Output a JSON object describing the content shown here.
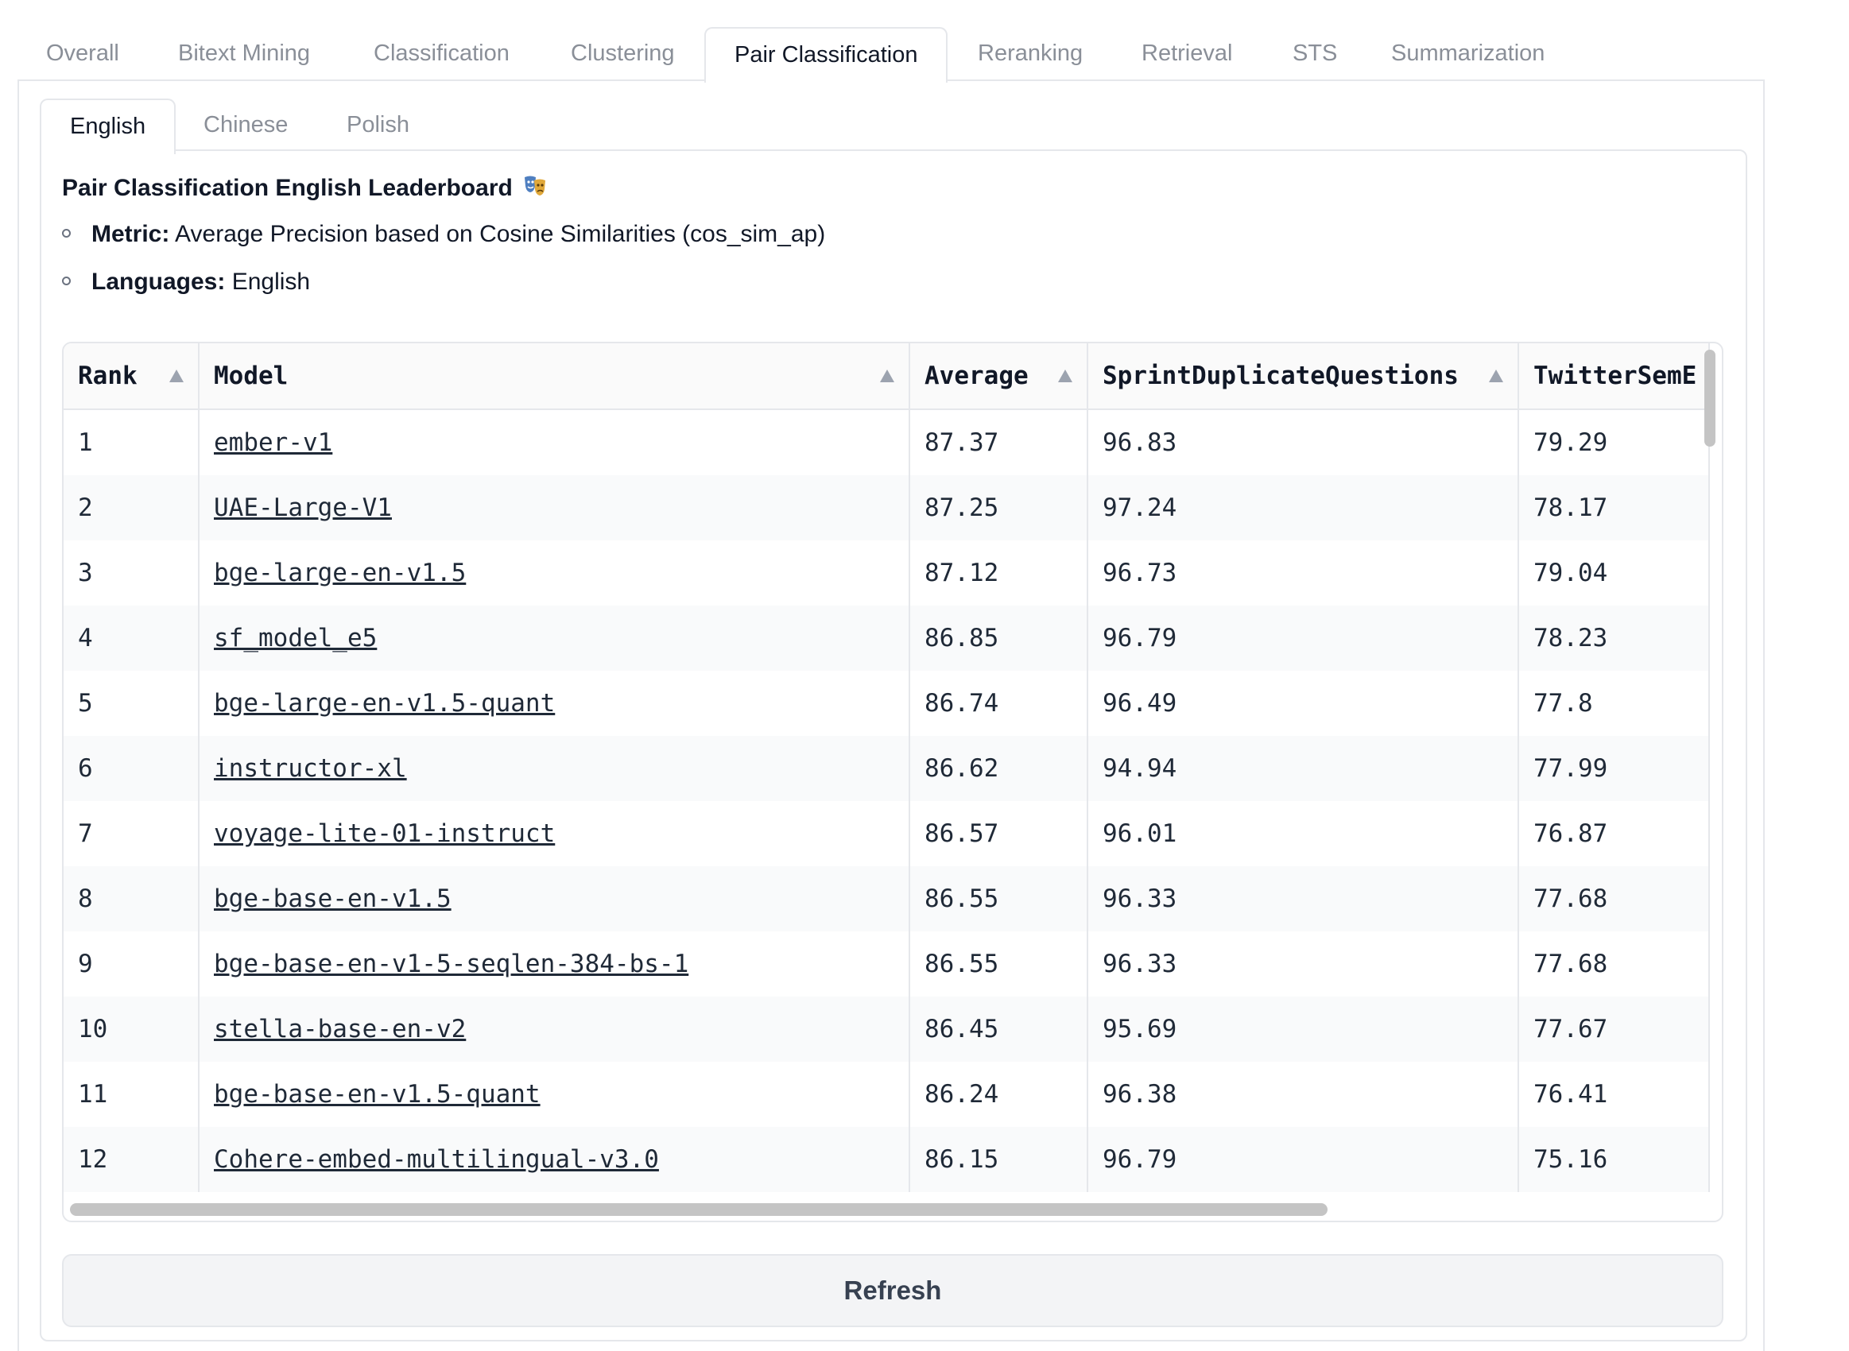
{
  "main_tabs": [
    "Overall",
    "Bitext Mining",
    "Classification",
    "Clustering",
    "Pair Classification",
    "Reranking",
    "Retrieval",
    "STS",
    "Summarization"
  ],
  "active_main_tab": "Pair Classification",
  "sub_tabs": [
    "English",
    "Chinese",
    "Polish"
  ],
  "active_sub_tab": "English",
  "leaderboard": {
    "title": "Pair Classification English Leaderboard",
    "metric_label": "Metric:",
    "metric_value": "Average Precision based on Cosine Similarities (cos_sim_ap)",
    "languages_label": "Languages:",
    "languages_value": "English"
  },
  "table": {
    "columns": [
      "Rank",
      "Model",
      "Average",
      "SprintDuplicateQuestions",
      "TwitterSemE"
    ],
    "rows": [
      [
        "1",
        "ember-v1",
        "87.37",
        "96.83",
        "79.29"
      ],
      [
        "2",
        "UAE-Large-V1",
        "87.25",
        "97.24",
        "78.17"
      ],
      [
        "3",
        "bge-large-en-v1.5",
        "87.12",
        "96.73",
        "79.04"
      ],
      [
        "4",
        "sf_model_e5",
        "86.85",
        "96.79",
        "78.23"
      ],
      [
        "5",
        "bge-large-en-v1.5-quant",
        "86.74",
        "96.49",
        "77.8"
      ],
      [
        "6",
        "instructor-xl",
        "86.62",
        "94.94",
        "77.99"
      ],
      [
        "7",
        "voyage-lite-01-instruct",
        "86.57",
        "96.01",
        "76.87"
      ],
      [
        "8",
        "bge-base-en-v1.5",
        "86.55",
        "96.33",
        "77.68"
      ],
      [
        "9",
        "bge-base-en-v1-5-seqlen-384-bs-1",
        "86.55",
        "96.33",
        "77.68"
      ],
      [
        "10",
        "stella-base-en-v2",
        "86.45",
        "95.69",
        "77.67"
      ],
      [
        "11",
        "bge-base-en-v1.5-quant",
        "86.24",
        "96.38",
        "76.41"
      ],
      [
        "12",
        "Cohere-embed-multilingual-v3.0",
        "86.15",
        "96.79",
        "75.16"
      ]
    ]
  },
  "refresh_label": "Refresh"
}
